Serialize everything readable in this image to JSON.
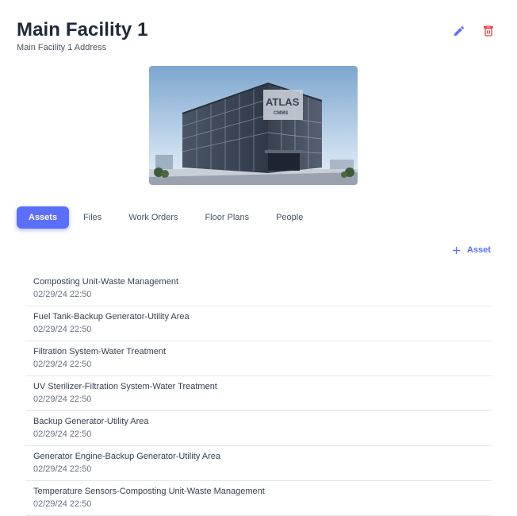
{
  "header": {
    "title": "Main Facility 1",
    "address": "Main Facility 1 Address"
  },
  "actions": {
    "edit_icon": "pencil-icon",
    "delete_icon": "trash-icon",
    "edit_color": "#5c6ff8",
    "delete_color": "#ef4444"
  },
  "image": {
    "brand_text": "ATLAS",
    "brand_sub": "CMMS"
  },
  "tabs": [
    {
      "label": "Assets",
      "active": true
    },
    {
      "label": "Files",
      "active": false
    },
    {
      "label": "Work Orders",
      "active": false
    },
    {
      "label": "Floor Plans",
      "active": false
    },
    {
      "label": "People",
      "active": false
    }
  ],
  "add_asset": {
    "icon": "plus-icon",
    "label": "Asset"
  },
  "assets": [
    {
      "name": "Composting Unit-Waste Management",
      "date": "02/29/24 22:50"
    },
    {
      "name": "Fuel Tank-Backup Generator-Utility Area",
      "date": "02/29/24 22:50"
    },
    {
      "name": "Filtration System-Water Treatment",
      "date": "02/29/24 22:50"
    },
    {
      "name": "UV Sterilizer-Filtration System-Water Treatment",
      "date": "02/29/24 22:50"
    },
    {
      "name": "Backup Generator-Utility Area",
      "date": "02/29/24 22:50"
    },
    {
      "name": "Generator Engine-Backup Generator-Utility Area",
      "date": "02/29/24 22:50"
    },
    {
      "name": "Temperature Sensors-Composting Unit-Waste Management",
      "date": "02/29/24 22:50"
    }
  ],
  "colors": {
    "accent": "#5c6ff8",
    "danger": "#ef4444",
    "divider": "#e5e7eb"
  }
}
